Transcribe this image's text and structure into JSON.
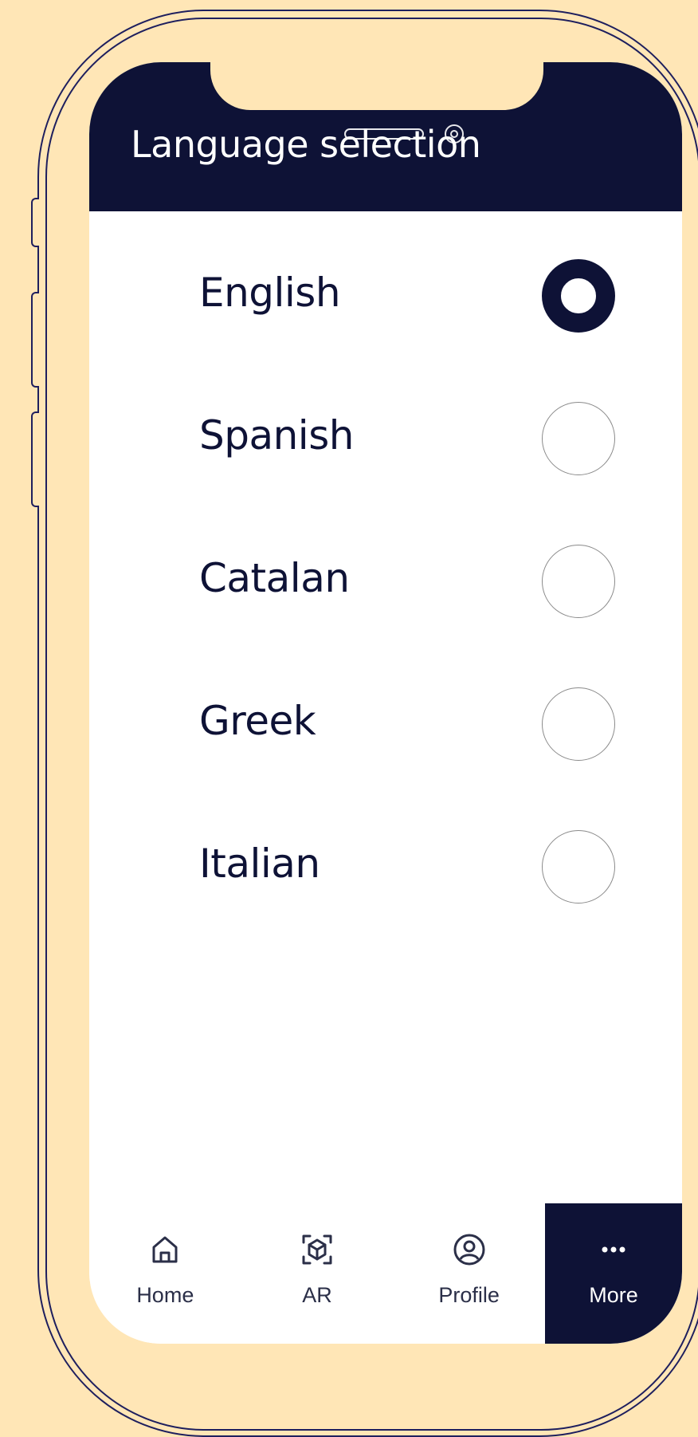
{
  "header": {
    "title": "Language selection"
  },
  "languages": [
    {
      "label": "English",
      "selected": true
    },
    {
      "label": "Spanish",
      "selected": false
    },
    {
      "label": "Catalan",
      "selected": false
    },
    {
      "label": "Greek",
      "selected": false
    },
    {
      "label": "Italian",
      "selected": false
    }
  ],
  "nav": {
    "items": [
      {
        "label": "Home",
        "icon": "home-icon",
        "active": false
      },
      {
        "label": "AR",
        "icon": "ar-cube-icon",
        "active": false
      },
      {
        "label": "Profile",
        "icon": "user-circle-icon",
        "active": false
      },
      {
        "label": "More",
        "icon": "more-dots-icon",
        "active": true
      }
    ]
  },
  "colors": {
    "background": "#FFE6B6",
    "primary": "#0E1236",
    "surface": "#FFFFFF"
  }
}
